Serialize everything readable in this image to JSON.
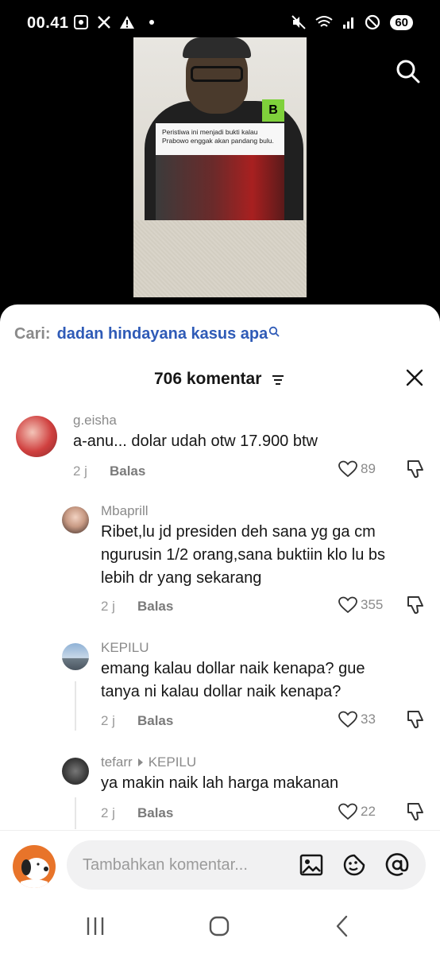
{
  "status_bar": {
    "time": "00.41",
    "battery": "60"
  },
  "video": {
    "overlay_text": "Peristiwa ini menjadi bukti kalau Prabowo enggak akan pandang bulu.",
    "badge_letter": "B"
  },
  "search": {
    "label": "Cari:",
    "query": "dadan hindayana kasus apa"
  },
  "comments_header": {
    "count_label": "706 komentar"
  },
  "comments": [
    {
      "username": "g.eisha",
      "text": "a-anu... dolar udah otw 17.900 btw",
      "time": "2 j",
      "reply_label": "Balas",
      "likes": "89"
    },
    {
      "username": "Mbaprill",
      "text_lines": [
        "Ribet,lu jd presiden deh sana yg ga cm",
        "ngurusin 1/2 orang,sana buktiin klo lu bs",
        "lebih dr yang sekarang"
      ],
      "time": "2 j",
      "reply_label": "Balas",
      "likes": "355"
    },
    {
      "username": "KEPILU",
      "text_lines": [
        "emang kalau dollar naik kenapa? gue",
        "tanya ni kalau dollar naik kenapa?"
      ],
      "time": "2 j",
      "reply_label": "Balas",
      "likes": "33"
    },
    {
      "username": "tefarr",
      "reply_to": "KEPILU",
      "text": "ya makin naik lah harga makanan",
      "time": "2 j",
      "reply_label": "Balas",
      "likes": "22"
    }
  ],
  "input": {
    "placeholder": "Tambahkan komentar..."
  }
}
